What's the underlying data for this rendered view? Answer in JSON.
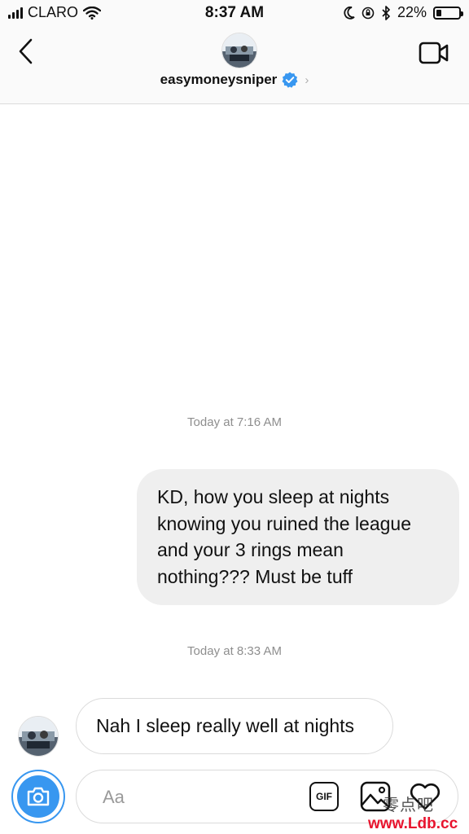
{
  "status_bar": {
    "carrier": "CLARO",
    "time": "8:37 AM",
    "battery_text": "22%",
    "battery_level": 0.22,
    "icons": [
      "signal-icon",
      "wifi-icon",
      "moon-icon",
      "orientation-lock-icon",
      "bluetooth-icon",
      "battery-icon"
    ]
  },
  "header": {
    "username": "easymoneysniper",
    "verified": true,
    "icons": [
      "back-icon",
      "video-call-icon",
      "verified-badge-icon",
      "chevron-right-icon"
    ]
  },
  "conversation": {
    "messages": [
      {
        "timestamp": "Today at 7:16 AM",
        "direction": "outgoing",
        "text": "KD, how you sleep at nights knowing you ruined the league and your 3 rings mean nothing??? Must be tuff"
      },
      {
        "timestamp": "Today at 8:33 AM",
        "direction": "incoming",
        "text": "Nah I sleep really well at nights"
      }
    ]
  },
  "composer": {
    "placeholder": "Aa",
    "gif_label": "GIF",
    "icons": [
      "camera-icon",
      "gif-icon",
      "gallery-icon",
      "heart-icon"
    ]
  },
  "watermark": {
    "chinese": "零点吧",
    "url": "www.Ldb.cc"
  },
  "colors": {
    "accent_blue": "#3897f0",
    "outgoing_bubble": "#efefef",
    "timestamp_gray": "#8e8e8e",
    "watermark_red": "#e8142e"
  }
}
